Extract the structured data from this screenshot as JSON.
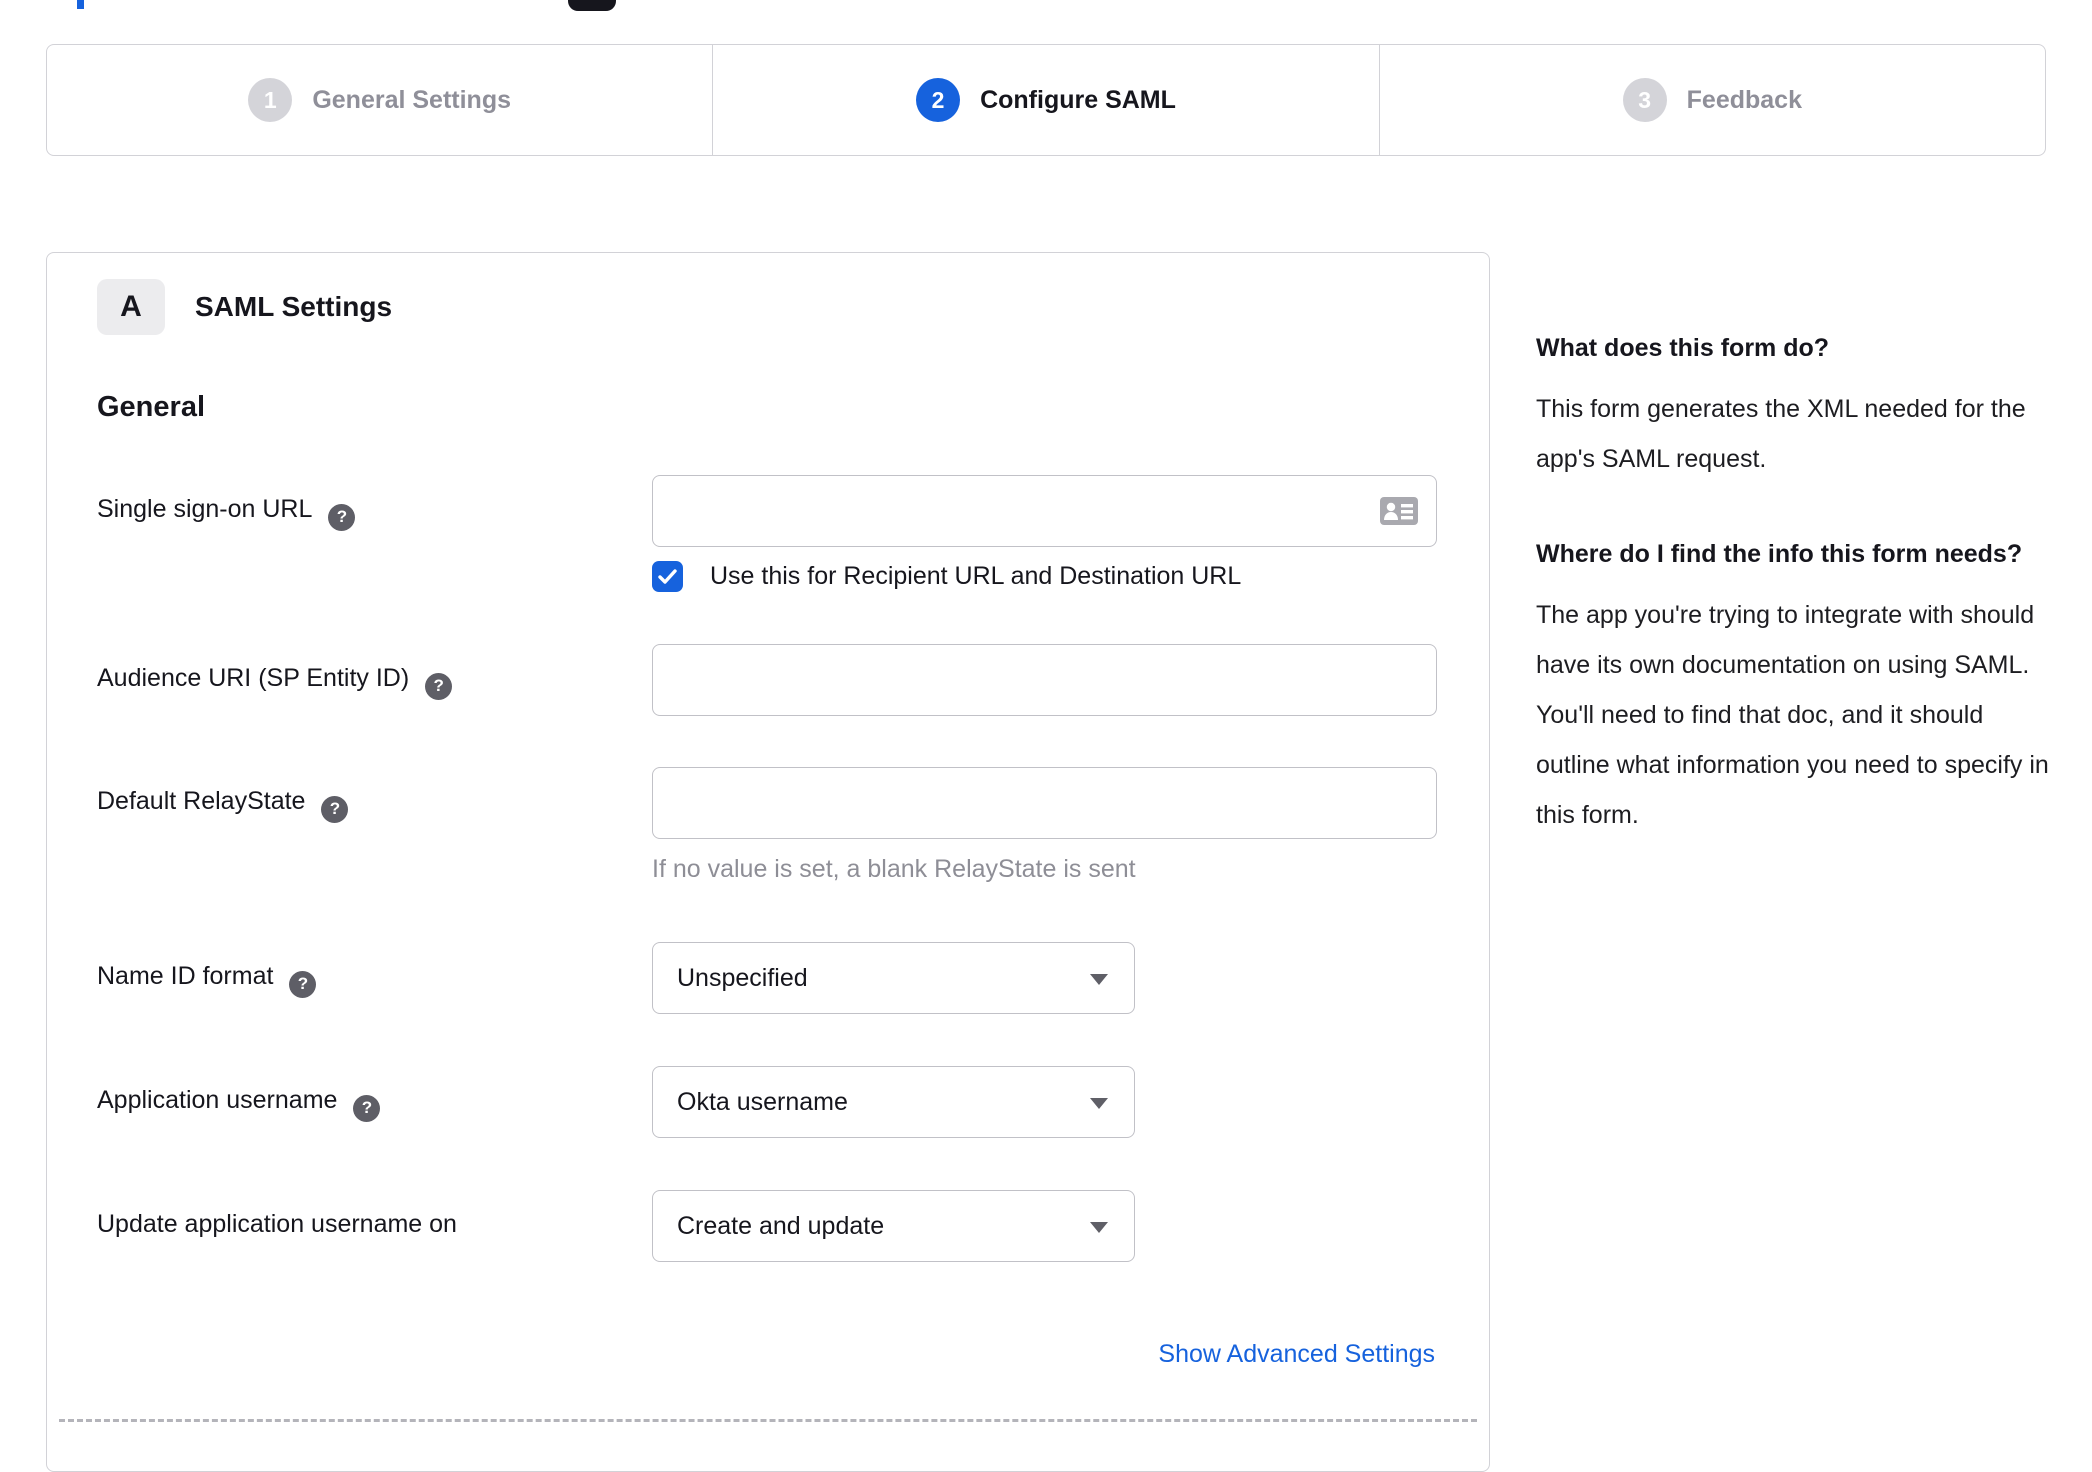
{
  "glyphs": {
    "question": "?"
  },
  "colors": {
    "accent_blue": "#1662dd",
    "inactive_gray": "#d4d4d9",
    "border_gray": "#d2d2d7",
    "help_icon_gray": "#5e5e66"
  },
  "stepper": {
    "steps": [
      {
        "number": "1",
        "label": "General Settings",
        "state": "inactive"
      },
      {
        "number": "2",
        "label": "Configure SAML",
        "state": "active"
      },
      {
        "number": "3",
        "label": "Feedback",
        "state": "inactive"
      }
    ]
  },
  "panel": {
    "badge": "A",
    "title": "SAML Settings",
    "section_heading": "General",
    "advanced_link": "Show Advanced Settings"
  },
  "form": {
    "sso_url": {
      "label": "Single sign-on URL",
      "value": "",
      "checkbox_label": "Use this for Recipient URL and Destination URL",
      "checked": true
    },
    "audience_uri": {
      "label": "Audience URI (SP Entity ID)",
      "value": ""
    },
    "relay_state": {
      "label": "Default RelayState",
      "value": "",
      "helper": "If no value is set, a blank RelayState is sent"
    },
    "name_id_format": {
      "label": "Name ID format",
      "value": "Unspecified"
    },
    "app_username": {
      "label": "Application username",
      "value": "Okta username"
    },
    "update_app_username": {
      "label": "Update application username on",
      "value": "Create and update"
    }
  },
  "help_panel": {
    "sections": [
      {
        "heading": "What does this form do?",
        "body": "This form generates the XML needed for the app's SAML request."
      },
      {
        "heading": "Where do I find the info this form needs?",
        "body": "The app you're trying to integrate with should have its own documentation on using SAML. You'll need to find that doc, and it should outline what information you need to specify in this form."
      }
    ]
  }
}
